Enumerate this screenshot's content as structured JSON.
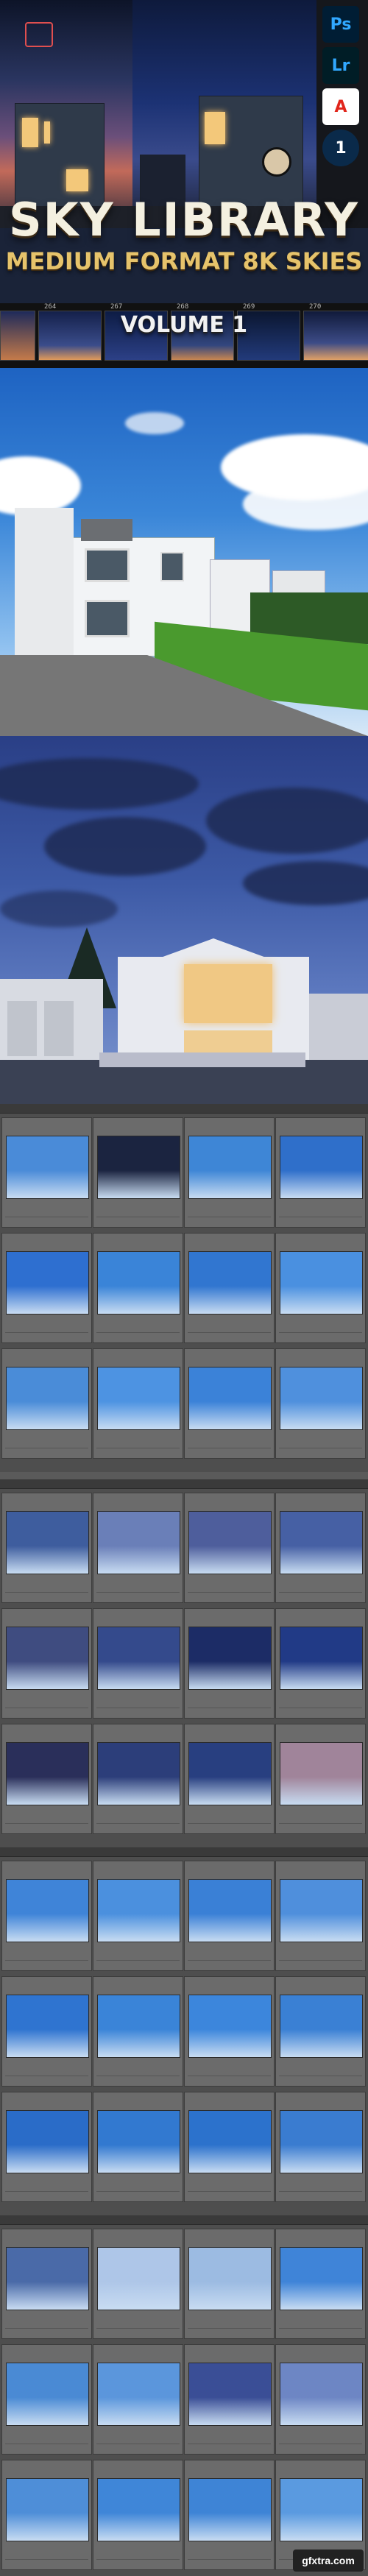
{
  "title": {
    "line1": "SKY LIBRARY",
    "line2": "MEDIUM FORMAT 8K SKIES",
    "line3": "VOLUME 1"
  },
  "badges": [
    {
      "label": "Ps",
      "icon": "photoshop-icon",
      "bg": "#001d34",
      "fg": "#31a8ff"
    },
    {
      "label": "Lr",
      "icon": "lightroom-icon",
      "bg": "#001d26",
      "fg": "#31a8ff"
    },
    {
      "label": "A",
      "icon": "adobe-icon",
      "bg": "#ffffff",
      "fg": "#e1251b"
    },
    {
      "label": "1",
      "icon": "luminar-icon",
      "bg": "#0a2a4a",
      "fg": "#ffffff"
    }
  ],
  "filmstrip": {
    "numbers": [
      "264",
      "267",
      "268",
      "269",
      "270"
    ]
  },
  "grid": {
    "captions": [
      [
        "",
        "",
        "",
        ""
      ],
      [
        "",
        "",
        "",
        ""
      ],
      [
        "",
        "",
        "",
        ""
      ]
    ],
    "thumb_colors": [
      [
        "#4a8bd8",
        "#1b2440",
        "#3e86d6",
        "#2f6fca"
      ],
      [
        "#2e6fd0",
        "#3a84d8",
        "#3176d0",
        "#4a90e0"
      ],
      [
        "#4a8cd8",
        "#4d93e2",
        "#3b82d8",
        "#4f90dd"
      ],
      [
        "#3e5d9e",
        "#6a7fb8",
        "#4e5e9c",
        "#4660a4"
      ],
      [
        "#3f4c80",
        "#344a8c",
        "#1c2c66",
        "#213a86"
      ],
      [
        "#2a2f5a",
        "#2c3e7a",
        "#283f80",
        "#a0849a"
      ],
      [
        "#3f84d8",
        "#4b90de",
        "#3a80d6",
        "#4f8fdc"
      ],
      [
        "#2f74d0",
        "#3a84d8",
        "#3c86dc",
        "#3a80d4"
      ],
      [
        "#2a6cc8",
        "#3279d0",
        "#2c72cc",
        "#3a7cd0"
      ],
      [
        "#4a6aa8",
        "#aec6e8",
        "#9cbbe2",
        "#3f84d8"
      ],
      [
        "#4a8ad4",
        "#5b96dc",
        "#3a4e96",
        "#6d86c4"
      ],
      [
        "#4e8ed8",
        "#3f86d8",
        "#3e84d6",
        "#5a9ae0"
      ]
    ]
  },
  "watermark": "gfxtra.com"
}
